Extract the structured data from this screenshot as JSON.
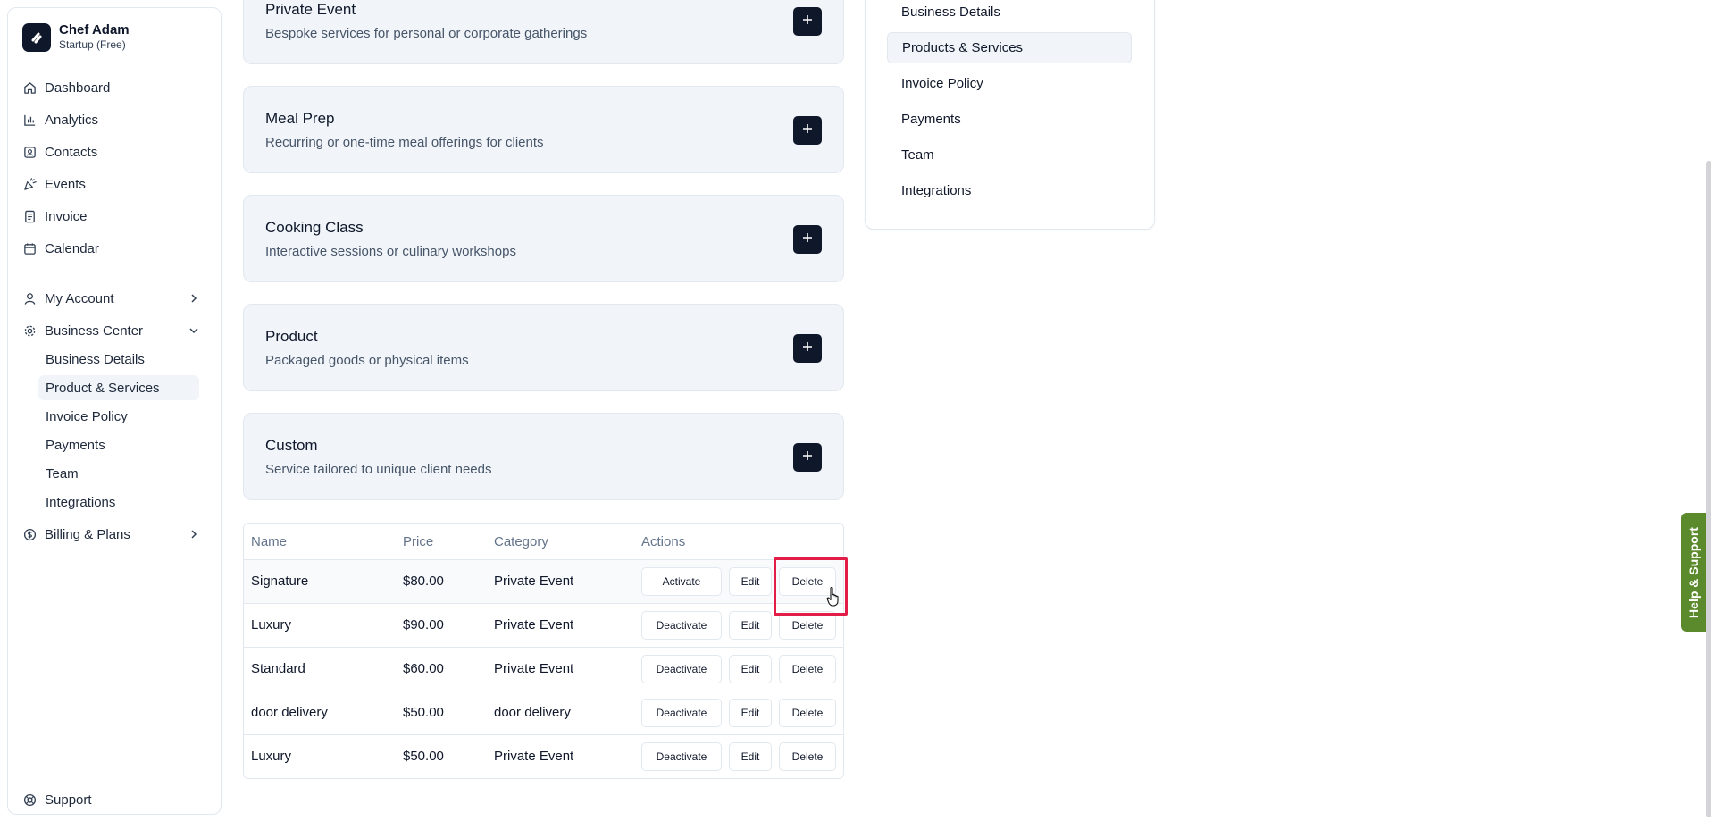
{
  "brand": {
    "name": "Chef Adam",
    "plan": "Startup (Free)"
  },
  "sidebar": {
    "items": [
      {
        "label": "Dashboard"
      },
      {
        "label": "Analytics"
      },
      {
        "label": "Contacts"
      },
      {
        "label": "Events"
      },
      {
        "label": "Invoice"
      },
      {
        "label": "Calendar"
      }
    ],
    "my_account": "My Account",
    "business_center": "Business Center",
    "business_sub": [
      {
        "label": "Business Details"
      },
      {
        "label": "Product & Services"
      },
      {
        "label": "Invoice Policy"
      },
      {
        "label": "Payments"
      },
      {
        "label": "Team"
      },
      {
        "label": "Integrations"
      }
    ],
    "billing": "Billing & Plans",
    "support": "Support"
  },
  "cards": [
    {
      "title": "Private Event",
      "desc": "Bespoke services for personal or corporate gatherings"
    },
    {
      "title": "Meal Prep",
      "desc": "Recurring or one-time meal offerings for clients"
    },
    {
      "title": "Cooking Class",
      "desc": "Interactive sessions or culinary workshops"
    },
    {
      "title": "Product",
      "desc": "Packaged goods or physical items"
    },
    {
      "title": "Custom",
      "desc": "Service tailored to unique client needs"
    }
  ],
  "table": {
    "headers": [
      "Name",
      "Price",
      "Category",
      "Actions"
    ],
    "rows": [
      {
        "name": "Signature",
        "price": "$80.00",
        "category": "Private Event",
        "toggle": "Activate"
      },
      {
        "name": "Luxury",
        "price": "$90.00",
        "category": "Private Event",
        "toggle": "Deactivate"
      },
      {
        "name": "Standard",
        "price": "$60.00",
        "category": "Private Event",
        "toggle": "Deactivate"
      },
      {
        "name": "door delivery",
        "price": "$50.00",
        "category": "door delivery",
        "toggle": "Deactivate"
      },
      {
        "name": "Luxury",
        "price": "$50.00",
        "category": "Private Event",
        "toggle": "Deactivate"
      }
    ],
    "edit_label": "Edit",
    "delete_label": "Delete"
  },
  "settings_nav": {
    "items": [
      {
        "label": "Business Details"
      },
      {
        "label": "Products & Services"
      },
      {
        "label": "Invoice Policy"
      },
      {
        "label": "Payments"
      },
      {
        "label": "Team"
      },
      {
        "label": "Integrations"
      }
    ]
  },
  "help_tab": "Help & Support",
  "colors": {
    "primary": "#0f172a",
    "highlight": "#e11d48",
    "help": "#5b8a2c",
    "card_bg": "#f1f5f9"
  }
}
